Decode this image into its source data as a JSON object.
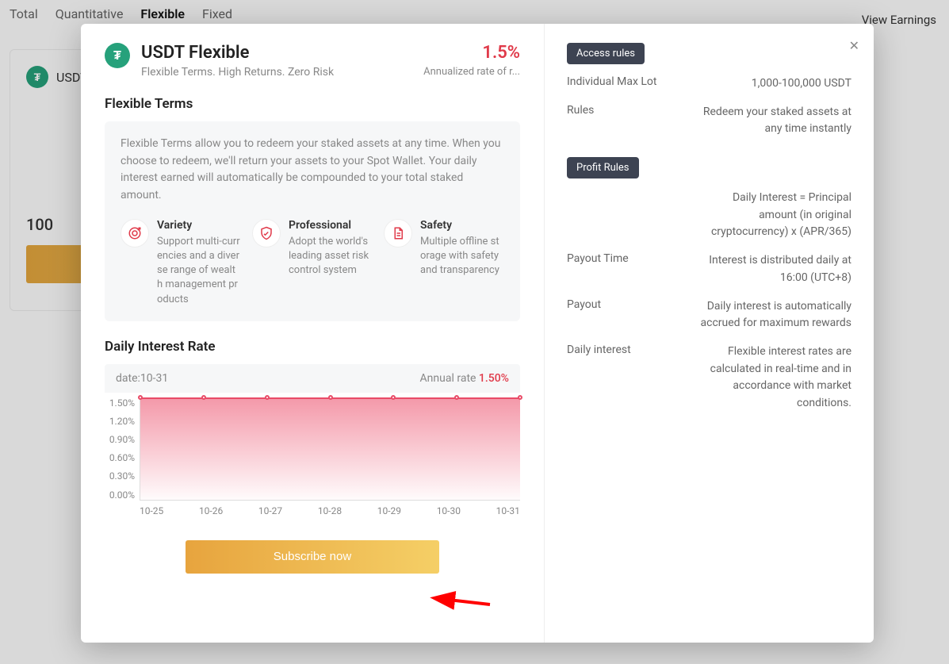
{
  "bg": {
    "tabs": [
      "Total",
      "Quantitative",
      "Flexible",
      "Fixed"
    ],
    "view_earnings": "View Earnings",
    "card_symbol": "USDT",
    "card_amount": "100"
  },
  "modal": {
    "coin_letter": "₮",
    "title": "USDT Flexible",
    "subtitle": "Flexible Terms. High Returns. Zero Risk",
    "rate": "1.5%",
    "rate_label": "Annualized rate of r...",
    "section_terms": "Flexible Terms",
    "terms_desc": "Flexible Terms allow you to redeem your staked assets at any time. When you choose to redeem, we'll return your assets to your Spot Wallet. Your daily interest earned will automatically be compounded to your total staked amount.",
    "features": [
      {
        "title": "Variety",
        "desc": "Support multi-currencies and a diverse range of wealth management products"
      },
      {
        "title": "Professional",
        "desc": "Adopt the world's leading asset risk control system"
      },
      {
        "title": "Safety",
        "desc": "Multiple offline storage with safety and transparency"
      }
    ],
    "section_chart": "Daily Interest Rate",
    "chart_info_date": "date:10-31",
    "chart_info_rate_label": "Annual rate ",
    "chart_info_rate_value": "1.50%",
    "subscribe": "Subscribe now"
  },
  "right": {
    "access_rules_label": "Access rules",
    "access": [
      {
        "label": "Individual Max Lot",
        "value": "1,000-100,000 USDT"
      },
      {
        "label": "Rules",
        "value": "Redeem your staked assets at any time instantly"
      }
    ],
    "profit_rules_label": "Profit Rules",
    "profit": [
      {
        "label": "",
        "value": "Daily Interest = Principal amount (in original cryptocurrency) x (APR/365)"
      },
      {
        "label": "Payout Time",
        "value": "Interest is distributed daily at 16:00 (UTC+8)"
      },
      {
        "label": "Payout",
        "value": "Daily interest is automatically accrued for maximum rewards"
      },
      {
        "label": "Daily interest",
        "value": "Flexible interest rates are calculated in real-time and in accordance with market conditions."
      }
    ]
  },
  "chart_data": {
    "type": "area",
    "title": "Daily Interest Rate",
    "xlabel": "",
    "ylabel": "",
    "ylim": [
      0,
      1.5
    ],
    "y_ticks": [
      "1.50%",
      "1.20%",
      "0.90%",
      "0.60%",
      "0.30%",
      "0.00%"
    ],
    "categories": [
      "10-25",
      "10-26",
      "10-27",
      "10-28",
      "10-29",
      "10-30",
      "10-31"
    ],
    "values": [
      1.5,
      1.5,
      1.5,
      1.5,
      1.5,
      1.5,
      1.5
    ],
    "series_name": "Annual rate"
  }
}
